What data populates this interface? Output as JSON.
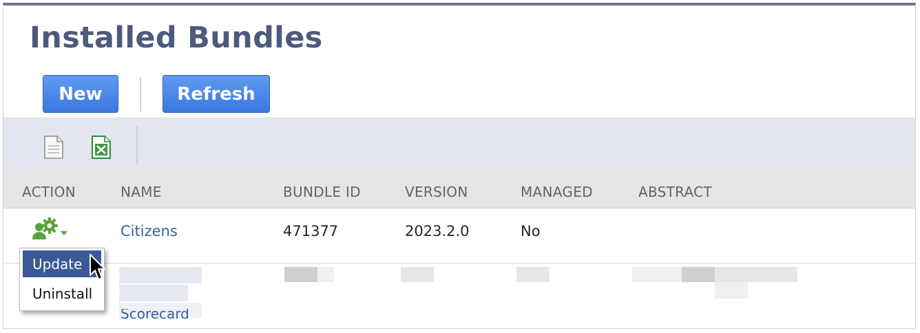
{
  "page": {
    "title": "Installed Bundles"
  },
  "buttons": {
    "new_label": "New",
    "refresh_label": "Refresh"
  },
  "toolbar": {
    "icons": [
      "document-icon",
      "excel-export-icon"
    ]
  },
  "table": {
    "columns": [
      "ACTION",
      "NAME",
      "BUNDLE ID",
      "VERSION",
      "MANAGED",
      "ABSTRACT"
    ],
    "rows": [
      {
        "name": "Citizens",
        "bundle_id": "471377",
        "version": "2023.2.0",
        "managed": "No",
        "abstract": ""
      }
    ],
    "row2_partial_name": "Scorecard"
  },
  "action_menu": {
    "items": [
      "Update",
      "Uninstall"
    ],
    "highlighted": "Update"
  },
  "colors": {
    "title": "#4d5a7c",
    "button": "#3a78df",
    "link": "#3b5e9e",
    "menu_highlight": "#3b5996",
    "header_bar": "#6c7596",
    "gear_green": "#5aa33c"
  }
}
